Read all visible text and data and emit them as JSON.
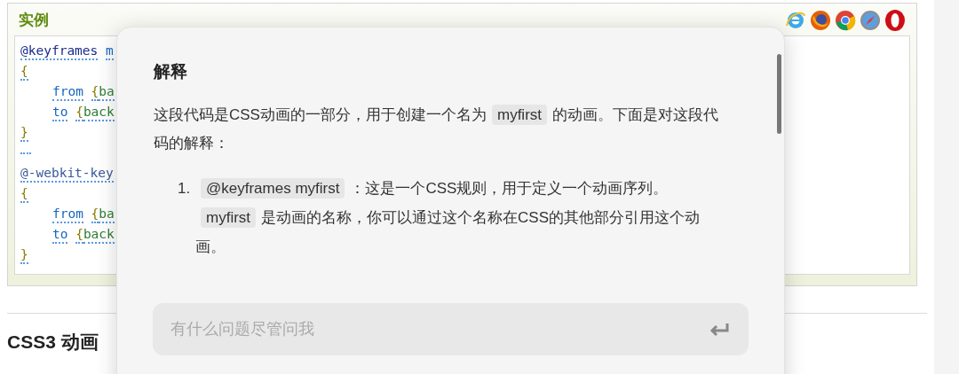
{
  "example": {
    "title": "实例",
    "browser_icons": [
      {
        "kind": "ie"
      },
      {
        "kind": "firefox"
      },
      {
        "kind": "chrome"
      },
      {
        "kind": "safari"
      },
      {
        "kind": "opera"
      }
    ],
    "code_lines": [
      {
        "kind": "code",
        "indent": false,
        "tokens": [
          {
            "kind": "at",
            "text": "@keyframes"
          },
          {
            "kind": "ident",
            "text": "m"
          }
        ]
      },
      {
        "kind": "code",
        "indent": false,
        "tokens": [
          {
            "kind": "brace",
            "text": "{"
          }
        ]
      },
      {
        "kind": "code",
        "indent": true,
        "tokens": [
          {
            "kind": "ident",
            "text": "from"
          },
          {
            "kind": "brace",
            "text": "{"
          },
          {
            "kind": "prop",
            "text": "ba"
          }
        ]
      },
      {
        "kind": "code",
        "indent": true,
        "tokens": [
          {
            "kind": "ident",
            "text": "to"
          },
          {
            "kind": "brace",
            "text": "{"
          },
          {
            "kind": "prop",
            "text": "back"
          }
        ]
      },
      {
        "kind": "code",
        "indent": false,
        "tokens": [
          {
            "kind": "brace",
            "text": "}"
          }
        ]
      },
      {
        "kind": "blank"
      },
      {
        "kind": "code",
        "indent": false,
        "tokens": [
          {
            "kind": "vendor",
            "text": "@-webkit-key"
          }
        ]
      },
      {
        "kind": "code",
        "indent": false,
        "tokens": [
          {
            "kind": "brace",
            "text": "{"
          }
        ]
      },
      {
        "kind": "code",
        "indent": true,
        "tokens": [
          {
            "kind": "ident",
            "text": "from"
          },
          {
            "kind": "brace",
            "text": "{"
          },
          {
            "kind": "prop",
            "text": "ba"
          }
        ]
      },
      {
        "kind": "code",
        "indent": true,
        "tokens": [
          {
            "kind": "ident",
            "text": "to"
          },
          {
            "kind": "brace",
            "text": "{"
          },
          {
            "kind": "prop",
            "text": "back"
          }
        ]
      },
      {
        "kind": "code",
        "indent": false,
        "tokens": [
          {
            "kind": "brace",
            "text": "}"
          }
        ]
      }
    ]
  },
  "heading": "CSS3 动画",
  "popup": {
    "title": "解释",
    "paragraph": [
      {
        "kind": "text",
        "text": "这段代码是CSS动画的一部分，用于创建一个名为"
      },
      {
        "kind": "code",
        "text": "myfirst"
      },
      {
        "kind": "text",
        "text": "的动画。下面是对这段代码的解释："
      }
    ],
    "list": [
      {
        "number": "1.",
        "parts": [
          {
            "kind": "code",
            "text": "@keyframes myfirst"
          },
          {
            "kind": "text",
            "text": "：这是一个CSS规则，用于定义一个动画序列。"
          },
          {
            "kind": "code",
            "text": "myfirst"
          },
          {
            "kind": "text",
            "text": "是动画的名称，你可以通过这个名称在CSS的其他部分引用这个动画。"
          }
        ]
      }
    ],
    "input": {
      "placeholder": "有什么问题尽管问我"
    }
  }
}
